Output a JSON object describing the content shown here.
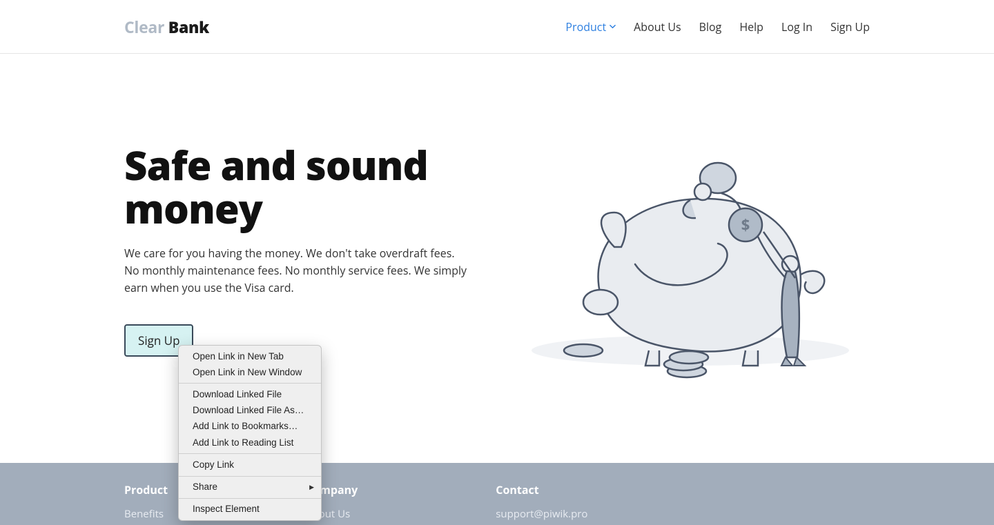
{
  "logo": {
    "part1": "Clear",
    "part2": " Bank"
  },
  "nav": {
    "product": "Product",
    "about": "About Us",
    "blog": "Blog",
    "help": "Help",
    "login": "Log In",
    "signup": "Sign Up"
  },
  "hero": {
    "title": "Safe and sound money",
    "desc": "We care for you having the money. We don't take overdraft fees. No monthly maintenance fees. No monthly service fees.  We simply earn when you use the Visa card.",
    "cta": "Sign Up"
  },
  "footer": {
    "col1": {
      "heading": "Product",
      "items": [
        "Benefits"
      ]
    },
    "col2": {
      "heading": "Company",
      "items": [
        "About Us"
      ]
    },
    "col3": {
      "heading": "Contact",
      "items": [
        "support@piwik.pro"
      ]
    }
  },
  "context_menu": {
    "group1": [
      "Open Link in New Tab",
      "Open Link in New Window"
    ],
    "group2": [
      "Download Linked File",
      "Download Linked File As…",
      "Add Link to Bookmarks…",
      "Add Link to Reading List"
    ],
    "group3": [
      "Copy Link"
    ],
    "group4": [
      {
        "label": "Share",
        "submenu": true
      }
    ],
    "group5": [
      "Inspect Element"
    ]
  }
}
